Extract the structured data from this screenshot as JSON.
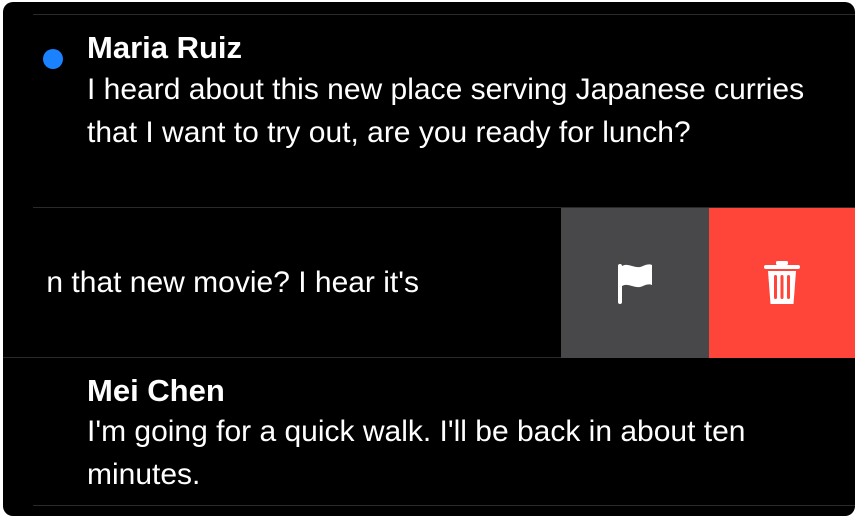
{
  "messages": [
    {
      "sender": "Maria Ruiz",
      "unread": true,
      "preview": "I heard about this new place serving Japanese curries that I want to try out, are you ready for lunch?"
    },
    {
      "sender": "",
      "unread": false,
      "preview_visible": "n that new movie? I hear it's",
      "swiped": true
    },
    {
      "sender": "Mei Chen",
      "unread": false,
      "preview": "I'm going for a quick walk. I'll be back in about ten minutes."
    }
  ],
  "swipe_actions": [
    {
      "icon": "flag-icon",
      "color": "#48484a"
    },
    {
      "icon": "trash-icon",
      "color": "#ff453a"
    }
  ],
  "colors": {
    "background": "#000000",
    "unread_dot": "#1a82ff",
    "flag_action": "#48484a",
    "delete_action": "#ff453a",
    "text": "#ffffff"
  }
}
